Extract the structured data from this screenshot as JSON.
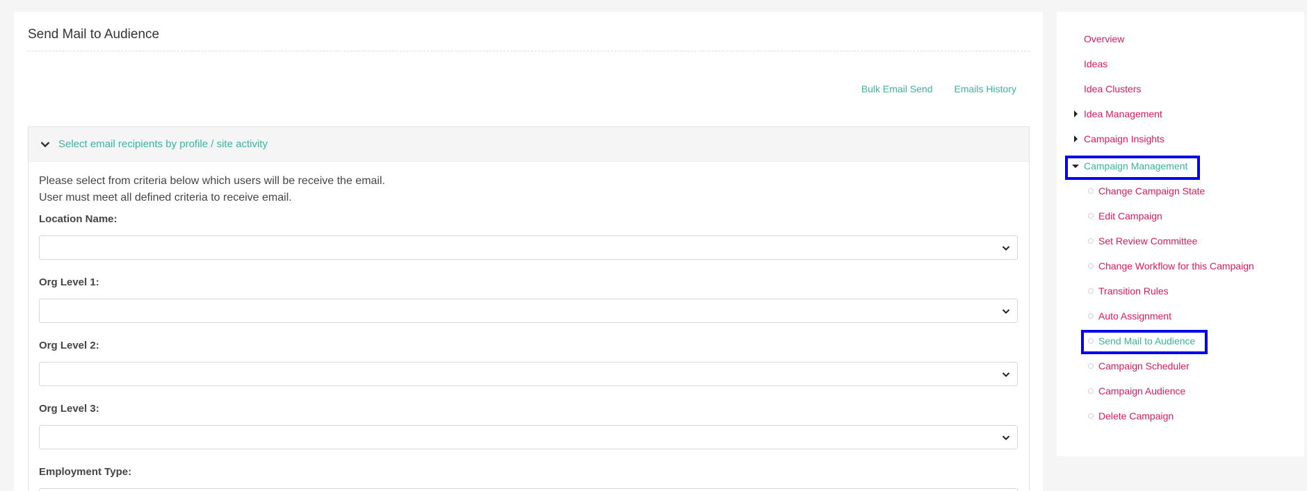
{
  "main": {
    "title": "Send Mail to Audience",
    "links": [
      {
        "label": "Bulk Email Send"
      },
      {
        "label": "Emails History"
      }
    ],
    "panel": {
      "header": "Select email recipients by profile / site activity",
      "intro_line1": "Please select from criteria below which users will be receive the email.",
      "intro_line2": "User must meet all defined criteria to receive email.",
      "fields": [
        {
          "label": "Location Name:",
          "value": ""
        },
        {
          "label": "Org Level 1:",
          "value": ""
        },
        {
          "label": "Org Level 2:",
          "value": ""
        },
        {
          "label": "Org Level 3:",
          "value": ""
        },
        {
          "label": "Employment Type:",
          "value": ""
        }
      ]
    }
  },
  "sidebar": {
    "items": [
      {
        "label": "Overview"
      },
      {
        "label": "Ideas"
      },
      {
        "label": "Idea Clusters"
      },
      {
        "label": "Idea Management",
        "expander": "collapsed"
      },
      {
        "label": "Campaign Insights",
        "expander": "collapsed"
      },
      {
        "label": "Campaign Management",
        "expander": "expanded",
        "active": true
      }
    ],
    "sub_items": [
      {
        "label": "Change Campaign State"
      },
      {
        "label": "Edit Campaign"
      },
      {
        "label": "Set Review Committee"
      },
      {
        "label": "Change Workflow for this Campaign"
      },
      {
        "label": "Transition Rules"
      },
      {
        "label": "Auto Assignment"
      },
      {
        "label": "Send Mail to Audience",
        "active": true
      },
      {
        "label": "Campaign Scheduler"
      },
      {
        "label": "Campaign Audience"
      },
      {
        "label": "Delete Campaign"
      }
    ]
  },
  "colors": {
    "accent": "#3ab3a0",
    "link_pink": "#e0195b",
    "highlight_blue": "#0000ee"
  }
}
